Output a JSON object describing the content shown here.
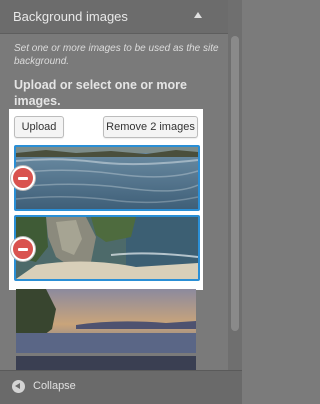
{
  "section": {
    "title": "Background images",
    "description": "Set one or more images to be used as the site background.",
    "heading": "Upload or select one or more images."
  },
  "picker": {
    "upload_label": "Upload",
    "remove_label": "Remove 2 images"
  },
  "footer": {
    "collapse_label": "Collapse"
  },
  "colors": {
    "selection_border": "#2a8fd6",
    "remove_icon": "#d9534f"
  }
}
